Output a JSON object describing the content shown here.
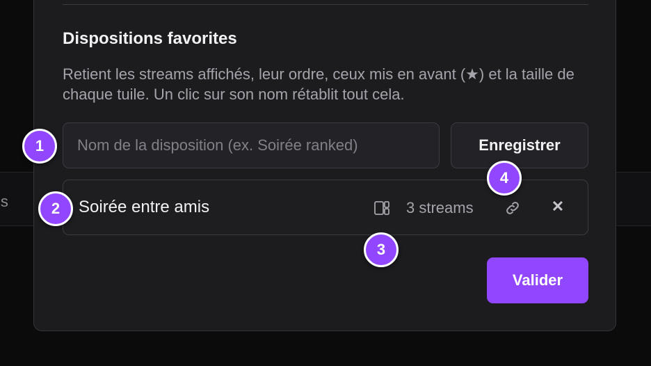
{
  "background": {
    "partial_text": "is"
  },
  "section": {
    "title": "Dispositions favorites",
    "description": "Retient les streams affichés, leur ordre, ceux mis en avant (★) et la taille de chaque tuile. Un clic sur son nom rétablit tout cela."
  },
  "form": {
    "name_placeholder": "Nom de la disposition (ex. Soirée ranked)",
    "name_value": "",
    "save_label": "Enregistrer"
  },
  "layouts": [
    {
      "name": "Soirée entre amis",
      "count_label": "3 streams",
      "icon": "layout-grid-icon"
    }
  ],
  "actions": {
    "validate_label": "Valider"
  },
  "badges": [
    "1",
    "2",
    "3",
    "4"
  ],
  "colors": {
    "accent": "#9146ff",
    "panel": "#1c1c1f",
    "background": "#0b0b0c"
  }
}
